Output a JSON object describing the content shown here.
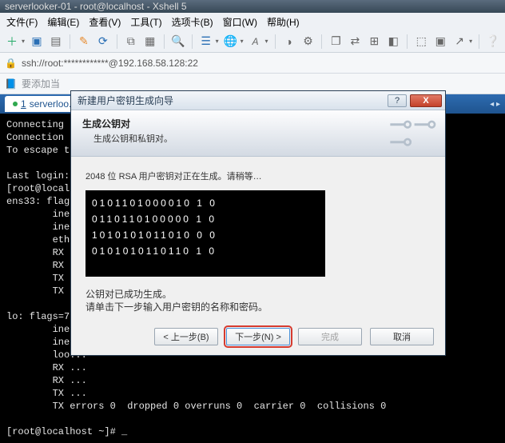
{
  "window": {
    "title": "serverlooker-01 - root@localhost - Xshell 5"
  },
  "menu": {
    "file": "文件(F)",
    "edit": "编辑(E)",
    "view": "查看(V)",
    "tool": "工具(T)",
    "tab": "选项卡(B)",
    "window": "窗口(W)",
    "help": "帮助(H)"
  },
  "address": {
    "lock": "🔒",
    "url": "ssh://root:************@192.168.58.128:22"
  },
  "addbar": {
    "book": "📘",
    "hint": "要添加当前会话，点击左侧的箭头按钮。"
  },
  "tab": {
    "num": "1",
    "name": "serverloo..."
  },
  "terminal": "Connecting ...\nConnection ...\nTo escape t...\n\nLast login: ...\n[root@local...\nens33: flag...\n        ine...\n        ine...\n        eth...\n        RX ...\n        RX ...\n        TX ...\n        TX ...\n\nlo: flags=7...\n        ine...\n        ine...\n        loo...\n        RX ...\n        RX ...\n        TX ...\n        TX errors 0  dropped 0 overruns 0  carrier 0  collisions 0\n\n[root@localhost ~]# _",
  "modal": {
    "title": "新建用户密钥生成向导",
    "help": "?",
    "close": "X",
    "heading": "生成公钥对",
    "subheading": "生成公钥和私钥对。",
    "generating": "2048 位 RSA 用户密钥对正在生成。请稍等…",
    "binary": [
      "0101101000010 1 0",
      "0110110100000 1 0",
      "1010101011010 0 0",
      "0101010110110 1 0"
    ],
    "done1": "公钥对已成功生成。",
    "done2": "请单击下一步输入用户密钥的名称和密码。",
    "btnBack": "< 上一步(B)",
    "btnNext": "下一步(N) >",
    "btnFinish": "完成",
    "btnCancel": "取消"
  }
}
